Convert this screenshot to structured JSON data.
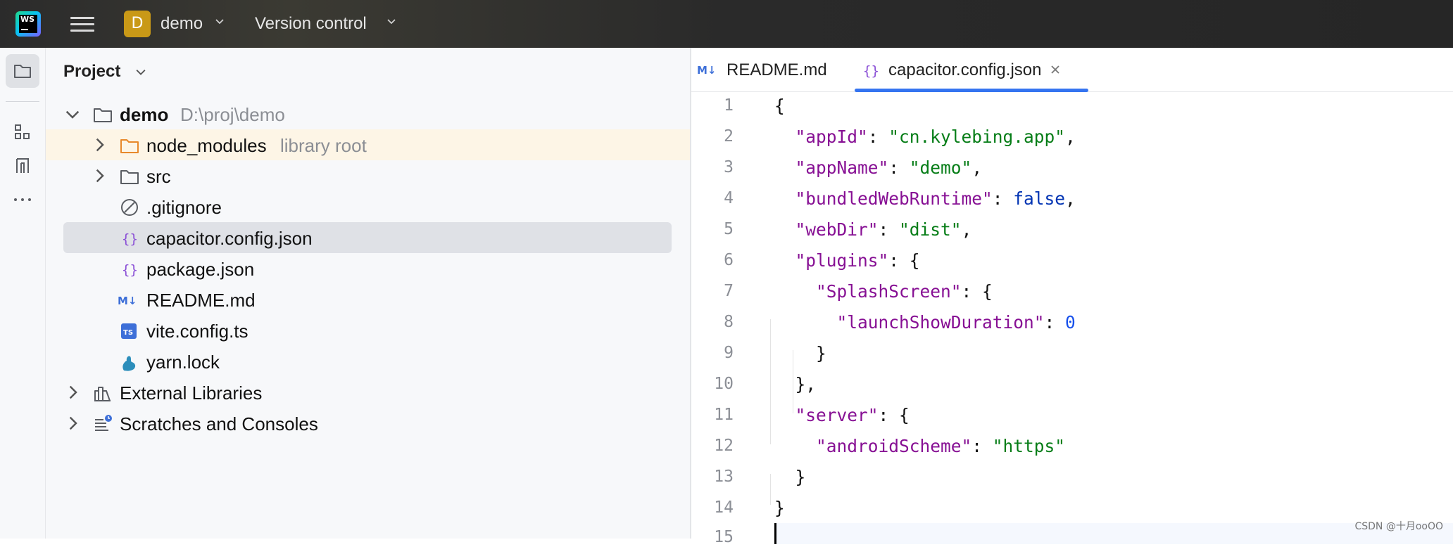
{
  "topbar": {
    "project_initial": "D",
    "project_name": "demo",
    "vcs_label": "Version control"
  },
  "toolstrip": {
    "items": [
      "project-tool",
      "structure-tool",
      "bookmarks-tool",
      "more-tools"
    ]
  },
  "project_panel": {
    "title": "Project",
    "tree": [
      {
        "label": "demo",
        "hint": "D:\\proj\\demo",
        "icon": "folder-icon",
        "expanded": true
      },
      {
        "label": "node_modules",
        "hint": "library root",
        "icon": "folder-orange-icon",
        "expanded": false
      },
      {
        "label": "src",
        "icon": "folder-icon",
        "expanded": false
      },
      {
        "label": ".gitignore",
        "icon": "ignore-file-icon"
      },
      {
        "label": "capacitor.config.json",
        "icon": "json-file-icon",
        "selected": true
      },
      {
        "label": "package.json",
        "icon": "json-file-icon"
      },
      {
        "label": "README.md",
        "icon": "markdown-file-icon"
      },
      {
        "label": "vite.config.ts",
        "icon": "typescript-file-icon"
      },
      {
        "label": "yarn.lock",
        "icon": "yarn-file-icon"
      },
      {
        "label": "External Libraries",
        "icon": "libraries-icon",
        "expanded": false
      },
      {
        "label": "Scratches and Consoles",
        "icon": "scratches-icon",
        "expanded": false
      }
    ]
  },
  "editor": {
    "tabs": [
      {
        "label": "README.md",
        "icon": "markdown-file-icon",
        "active": false
      },
      {
        "label": "capacitor.config.json",
        "icon": "json-file-icon",
        "active": true
      }
    ],
    "line_numbers": [
      "1",
      "2",
      "3",
      "4",
      "5",
      "6",
      "7",
      "8",
      "9",
      "10",
      "11",
      "12",
      "13",
      "14",
      "15"
    ],
    "tokens": {
      "open_brace": "{",
      "close_brace": "}",
      "close_brace_comma": "},",
      "colon": ": ",
      "comma": ",",
      "k_appId": "\"appId\"",
      "v_appId": "\"cn.kylebing.app\"",
      "k_appName": "\"appName\"",
      "v_appName": "\"demo\"",
      "k_bundled": "\"bundledWebRuntime\"",
      "v_bundled": "false",
      "k_webDir": "\"webDir\"",
      "v_webDir": "\"dist\"",
      "k_plugins": "\"plugins\"",
      "k_splash": "\"SplashScreen\"",
      "k_launch": "\"launchShowDuration\"",
      "v_launch": "0",
      "k_server": "\"server\"",
      "k_android": "\"androidScheme\"",
      "v_android": "\"https\""
    }
  },
  "watermark": "CSDN @十月ooOO",
  "colors": {
    "accent": "#3574f0",
    "json_key": "#871094",
    "json_string": "#067d17",
    "json_keyword": "#0033b3",
    "json_number": "#1750eb",
    "project_badge": "#c99917"
  }
}
